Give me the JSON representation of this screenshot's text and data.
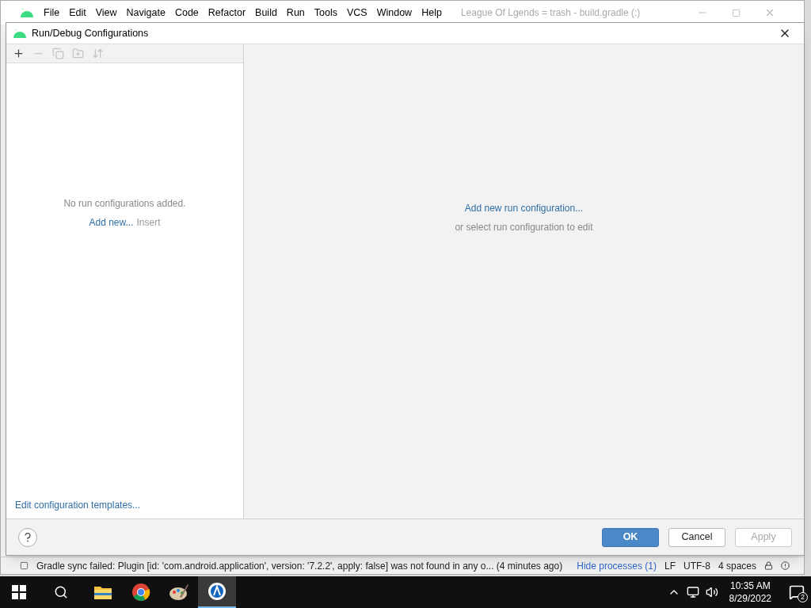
{
  "ide": {
    "menu": [
      "File",
      "Edit",
      "View",
      "Navigate",
      "Code",
      "Refactor",
      "Build",
      "Run",
      "Tools",
      "VCS",
      "Window",
      "Help"
    ],
    "title": "League Of Lgends = trash - build.gradle (:)"
  },
  "dialog": {
    "title": "Run/Debug Configurations",
    "toolbar": [
      {
        "kind": "add",
        "disabled": false
      },
      {
        "kind": "remove",
        "disabled": true
      },
      {
        "kind": "copy",
        "disabled": true
      },
      {
        "kind": "folder",
        "disabled": true
      },
      {
        "kind": "sort",
        "disabled": true
      }
    ],
    "empty_list": {
      "message": "No run configurations added.",
      "link": "Add new...",
      "shortcut": "Insert"
    },
    "templates_link": "Edit configuration templates...",
    "main": {
      "link": "Add new run configuration...",
      "hint": "or select run configuration to edit"
    },
    "buttons": [
      {
        "label": "OK",
        "kind": "primary",
        "disabled": false
      },
      {
        "label": "Cancel",
        "kind": "normal",
        "disabled": false
      },
      {
        "label": "Apply",
        "kind": "normal",
        "disabled": true
      }
    ]
  },
  "status_bar": {
    "message": "Gradle sync failed: Plugin [id: 'com.android.application', version: '7.2.2', apply: false] was not found in any o... (4 minutes ago)",
    "processes": "Hide processes (1)",
    "line_separator": "LF",
    "encoding": "UTF-8",
    "indent": "4 spaces"
  },
  "taskbar": {
    "apps": [
      {
        "kind": "explorer",
        "selected": false
      },
      {
        "kind": "chrome",
        "selected": false
      },
      {
        "kind": "paint",
        "selected": false
      },
      {
        "kind": "studio",
        "selected": true
      }
    ],
    "time": "10:35 AM",
    "date": "8/29/2022",
    "notifications": "2"
  }
}
